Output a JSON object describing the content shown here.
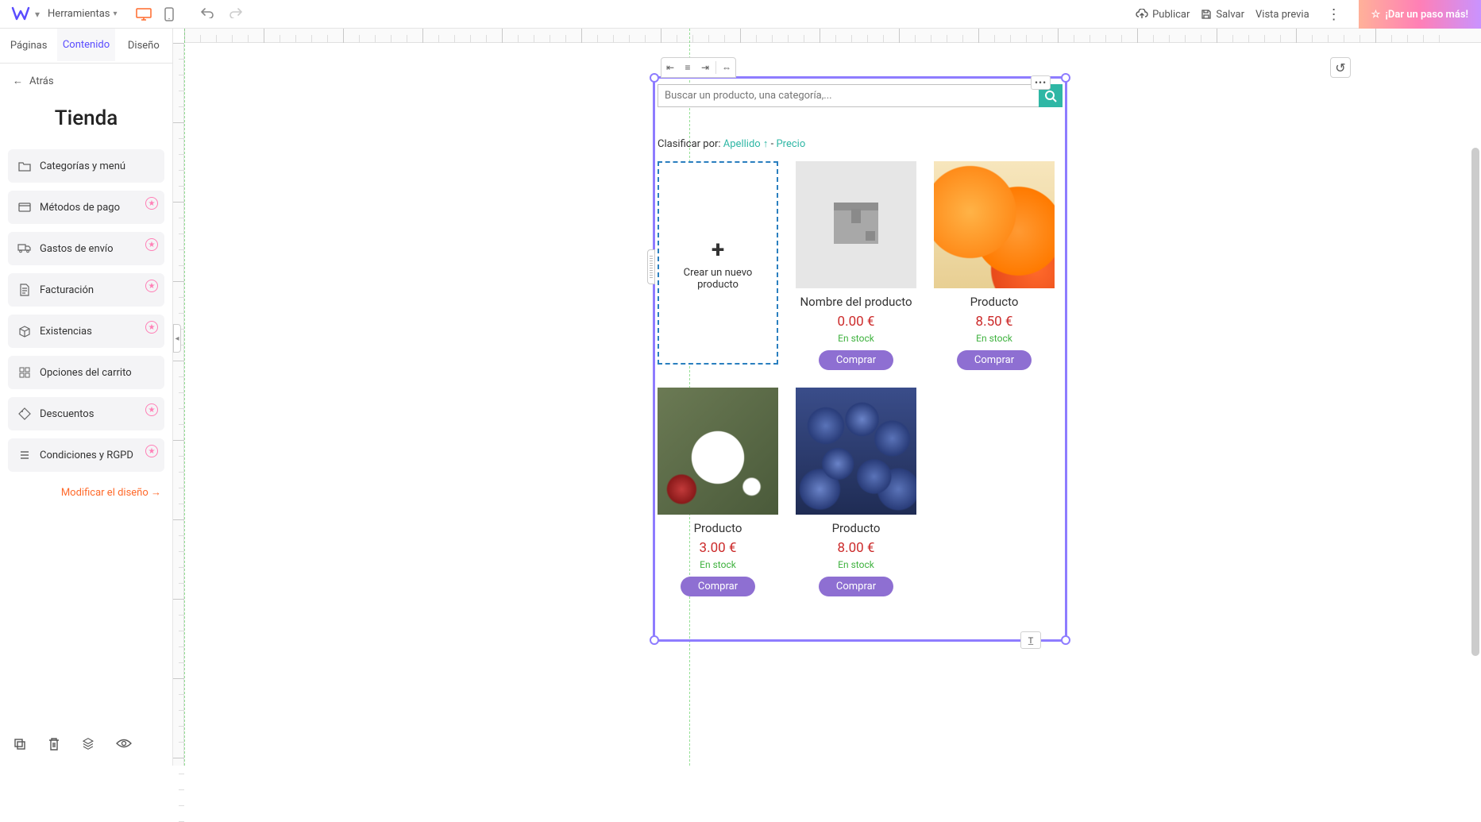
{
  "topbar": {
    "tools_label": "Herramientas",
    "publish": "Publicar",
    "save": "Salvar",
    "preview": "Vista previa",
    "cta": "¡Dar un paso más!"
  },
  "tabs": {
    "pages": "Páginas",
    "content": "Contenido",
    "design": "Diseño"
  },
  "back_label": "Atrás",
  "panel_title": "Tienda",
  "options": [
    {
      "label": "Categorías y menú",
      "star": false
    },
    {
      "label": "Métodos de pago",
      "star": true
    },
    {
      "label": "Gastos de envío",
      "star": true
    },
    {
      "label": "Facturación",
      "star": true
    },
    {
      "label": "Existencias",
      "star": true
    },
    {
      "label": "Opciones del carrito",
      "star": false
    },
    {
      "label": "Descuentos",
      "star": true
    },
    {
      "label": "Condiciones y RGPD",
      "star": true
    }
  ],
  "modify_design": "Modificar el diseño →",
  "search": {
    "placeholder": "Buscar un producto, una categoría,..."
  },
  "sort": {
    "prefix": "Clasificar por:",
    "name": "Apellido ↑",
    "sep": "-",
    "price": "Precio"
  },
  "new_product": "Crear un nuevo producto",
  "buy_label": "Comprar",
  "stock_label": "En stock",
  "products": [
    {
      "name": "Nombre del producto",
      "price": "0.00 €",
      "img": "box"
    },
    {
      "name": "Producto",
      "price": "8.50 €",
      "img": "oranges"
    },
    {
      "name": "Producto",
      "price": "3.00 €",
      "img": "berries-dish"
    },
    {
      "name": "Producto",
      "price": "8.00 €",
      "img": "blueberries"
    }
  ]
}
